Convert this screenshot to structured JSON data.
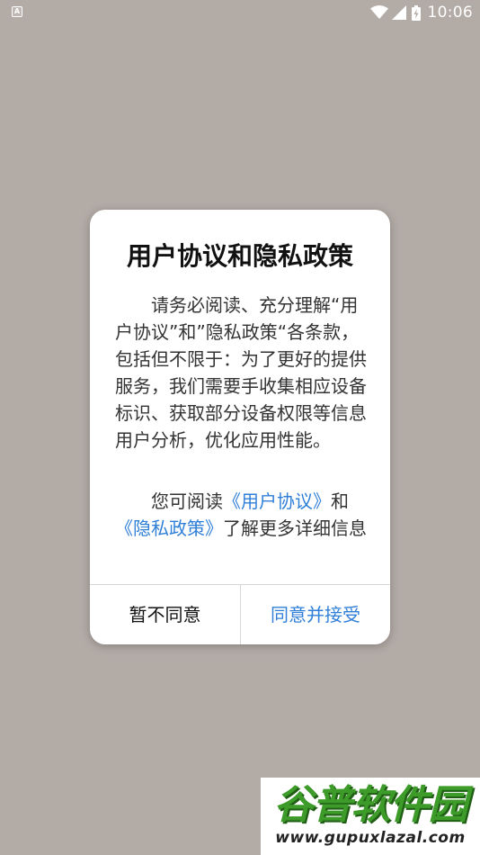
{
  "status_bar": {
    "notification_icon_letter": "A",
    "time": "10:06"
  },
  "dialog": {
    "title": "用户协议和隐私政策",
    "paragraph1": "请务必阅读、充分理解“用户协议”和”隐私政策“各条款，包括但不限于：为了更好的提供服务，我们需要手收集相应设备标识、获取部分设备权限等信息用户分析，优化应用性能。",
    "paragraph2_prefix": "您可阅读",
    "link_user_agreement": "《用户协议》",
    "paragraph2_and": "和",
    "link_privacy_policy": "《隐私政策》",
    "paragraph2_suffix": "了解更多详细信息",
    "decline_button": "暂不同意",
    "accept_button": "同意并接受"
  },
  "watermark": {
    "logo_text": "谷普软件园",
    "url": "www.gupuxlazal.com"
  },
  "colors": {
    "background": "#b3aba6",
    "link": "#2f7fd8",
    "accept_button": "#2f7fd8"
  }
}
